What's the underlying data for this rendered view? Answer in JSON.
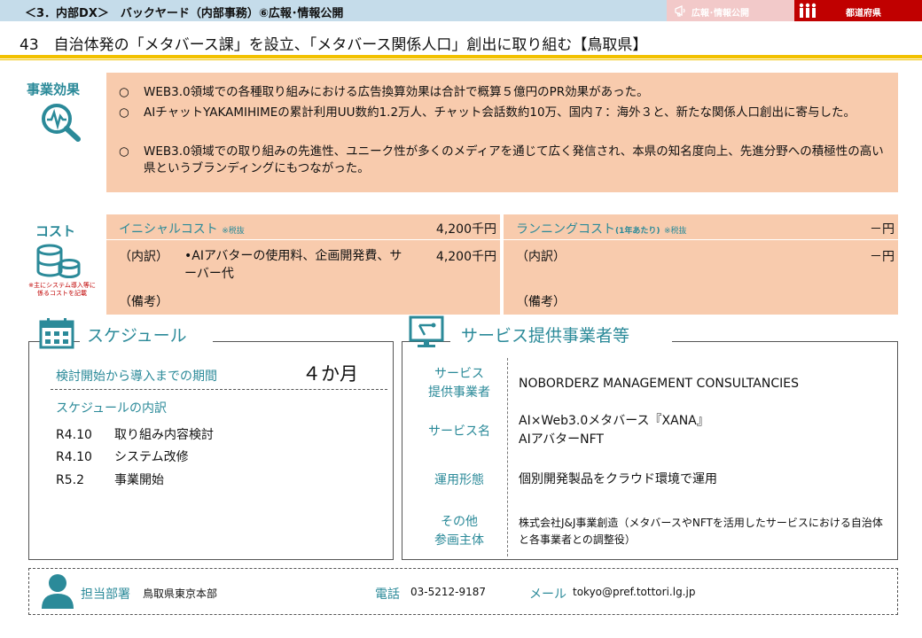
{
  "header": {
    "breadcrumb": "＜3．内部DX＞　バックヤード（内部事務）⑥広報･情報公開",
    "tag_category": "広報･情報公開",
    "tag_level": "都道府県"
  },
  "title": "43　自治体発の「メタバース課」を設立、「メタバース関係人口」創出に取り組む【鳥取県】",
  "effect": {
    "label": "事業効果",
    "items": [
      {
        "bullet": "○",
        "text": "WEB3.0領域での各種取り組みにおける広告換算効果は合計で概算５億円のPR効果があった。"
      },
      {
        "bullet": "○",
        "text": "AIチャットYAKAMIHIMEの累計利用UU数約1.2万人、チャット会話数約10万、国内７：海外３と、新たな関係人口創出に寄与した。"
      },
      {
        "bullet": "○",
        "text": "WEB3.0領域での取り組みの先進性、ユニーク性が多くのメディアを通じて広く発信され、本県の知名度向上、先進分野への積極性の高い県というブランディングにもつながった。"
      }
    ]
  },
  "cost": {
    "label": "コスト",
    "note": "※主にシステム導入等に係るコストを記載",
    "initial": {
      "name": "イニシャルコスト",
      "tax": "※税抜",
      "amount": "4,200千円",
      "breakdown_label": "（内訳）",
      "breakdown_text": "•AIアバターの使用料、企画開発費、サーバー代",
      "breakdown_amount": "4,200千円",
      "remarks_label": "（備考）"
    },
    "running": {
      "name": "ランニングコスト",
      "per_year": "(1年あたり)",
      "tax": "※税抜",
      "amount": "－円",
      "breakdown_label": "（内訳）",
      "breakdown_amount": "－円",
      "remarks_label": "（備考）"
    }
  },
  "schedule": {
    "title": "スケジュール",
    "period_label": "検討開始から導入までの期間",
    "period_value": "４か月",
    "breakdown_label": "スケジュールの内訳",
    "items": [
      {
        "date": "R4.10",
        "task": "取り組み内容検討"
      },
      {
        "date": "R4.10",
        "task": "システム改修"
      },
      {
        "date": "R5.2",
        "task": "事業開始"
      }
    ]
  },
  "service": {
    "title": "サービス提供事業者等",
    "provider_key_1": "サービス",
    "provider_key_2": "提供事業者",
    "provider_value": "NOBORDERZ MANAGEMENT CONSULTANCIES",
    "name_key": "サービス名",
    "name_value_1": "AI×Web3.0メタバース『XANA』",
    "name_value_2": "AIアバターNFT",
    "mode_key": "運用形態",
    "mode_value": "個別開発製品をクラウド環境で運用",
    "other_key_1": "その他",
    "other_key_2": "参画主体",
    "other_value": "株式会社J&J事業創造（メタバースやNFTを活用したサービスにおける自治体と各事業者との調整役）"
  },
  "contact": {
    "dept_label": "担当部署",
    "dept_value": "鳥取県東京本部",
    "phone_label": "電話",
    "phone_value": "03-5212-9187",
    "mail_label": "メール",
    "mail_value": "tokyo@pref.tottori.lg.jp"
  },
  "icons": {
    "category": "megaphone-icon",
    "level": "people-icon",
    "effect": "magnifier-chart-icon",
    "cost": "coins-icon",
    "schedule": "calendar-icon",
    "service": "monitor-icon",
    "contact": "person-icon"
  },
  "colors": {
    "teal": "#2b8a99",
    "peach": "#f8cbad",
    "header_blue": "#c5dcea",
    "tag_pink": "#f2c9c9",
    "tag_red": "#c00000",
    "title_line": "#f2c100"
  }
}
